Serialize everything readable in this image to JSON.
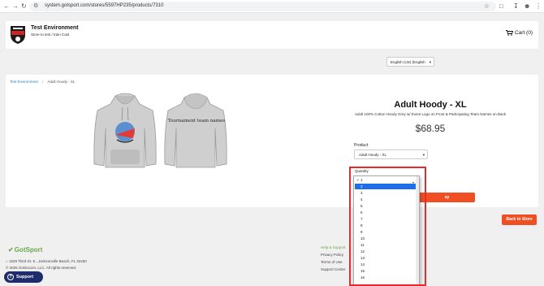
{
  "browser": {
    "url": "system.gotsport.com/stores/5597HP235/products/7310"
  },
  "header": {
    "store_title": "Test Environment",
    "store_subtitle": "Store to test / train Cast",
    "cart_label": "Cart (0)"
  },
  "language": {
    "selected": "English (US) (English"
  },
  "breadcrumb": {
    "root": "Test Environment",
    "separator": "/",
    "current": "Adult Hoody - XL"
  },
  "product": {
    "back_print": "Tournament team names",
    "title": "Adult Hoody - XL",
    "description": "Adult 100% Cotton Hoody Grey w/ Event Logo on Front & Participating Team Names on Back",
    "price": "$68.95",
    "product_label": "Product",
    "product_selected": "Adult Hoody - XL",
    "add_button_partial": "ay"
  },
  "quantity": {
    "label": "Quantity",
    "selected": "1",
    "hovered": "2",
    "options": [
      "1",
      "2",
      "3",
      "4",
      "5",
      "6",
      "7",
      "8",
      "9",
      "10",
      "11",
      "12",
      "13",
      "14",
      "15",
      "16"
    ]
  },
  "actions": {
    "back_to_store": "Back to Store"
  },
  "footer": {
    "logo": "GotSport",
    "address": "1529 Third St. S., Jacksonville Beach, FL 32250",
    "copyright": "© 2025 GotSoccer, LLC. All rights reserved.",
    "links": [
      "Help & Support",
      "Privacy Policy",
      "Terms of Use",
      "Support Center"
    ],
    "support_button": "Support"
  },
  "colors": {
    "accent": "#f04e23",
    "link": "#2c7dbf",
    "brand_green": "#6aa84f",
    "support_bg": "#1f2c6b",
    "highlight": "#e52b2b",
    "selected_option": "#1f6feb"
  },
  "icons": [
    "back-icon",
    "forward-icon",
    "reload-icon",
    "site-info-icon",
    "star-icon",
    "extensions-icon",
    "download-icon",
    "profile-icon",
    "menu-icon",
    "cart-icon",
    "checkmark-icon",
    "home-icon",
    "question-icon",
    "chevron-down-icon"
  ]
}
